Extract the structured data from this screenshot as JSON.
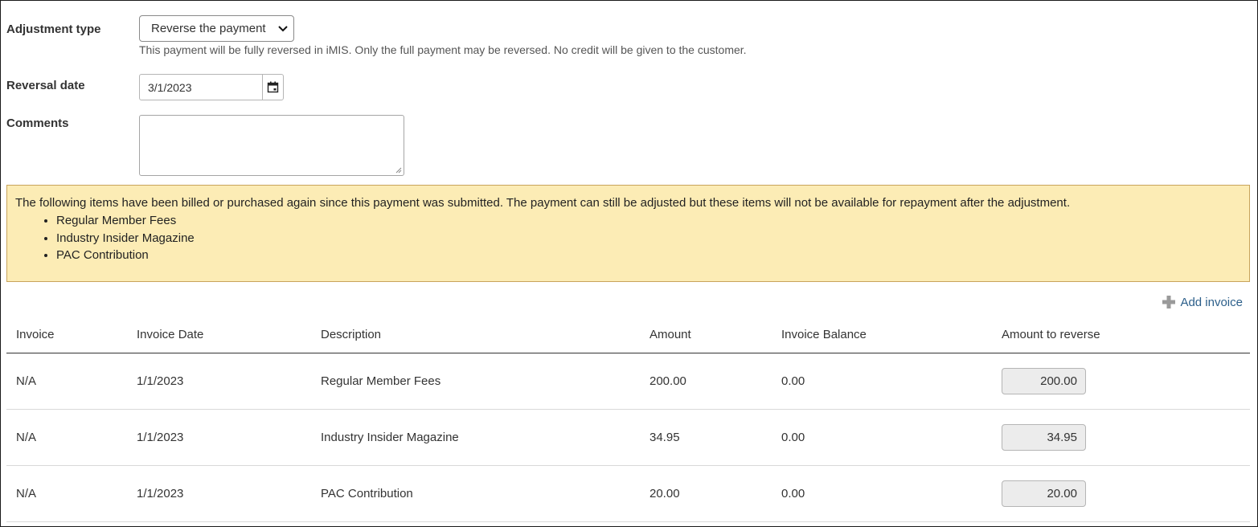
{
  "form": {
    "adjustment_type_label": "Adjustment type",
    "adjustment_type_value": "Reverse the payment",
    "adjustment_hint": "This payment will be fully reversed in iMIS. Only the full payment may be reversed. No credit will be given to the customer.",
    "reversal_date_label": "Reversal date",
    "reversal_date_value": "3/1/2023",
    "comments_label": "Comments",
    "comments_value": ""
  },
  "warning": {
    "message": "The following items have been billed or purchased again since this payment was submitted. The payment can still be adjusted but these items will not be available for repayment after the adjustment.",
    "items": [
      "Regular Member Fees",
      "Industry Insider Magazine",
      "PAC Contribution"
    ]
  },
  "add_invoice_label": "Add invoice",
  "table": {
    "headers": [
      "Invoice",
      "Invoice Date",
      "Description",
      "Amount",
      "Invoice Balance",
      "Amount to reverse"
    ],
    "rows": [
      {
        "invoice": "N/A",
        "date": "1/1/2023",
        "description": "Regular Member Fees",
        "amount": "200.00",
        "balance": "0.00",
        "reverse": "200.00"
      },
      {
        "invoice": "N/A",
        "date": "1/1/2023",
        "description": "Industry Insider Magazine",
        "amount": "34.95",
        "balance": "0.00",
        "reverse": "34.95"
      },
      {
        "invoice": "N/A",
        "date": "1/1/2023",
        "description": "PAC Contribution",
        "amount": "20.00",
        "balance": "0.00",
        "reverse": "20.00"
      }
    ]
  },
  "icons": {
    "select_arrow": "chevron-down-icon",
    "calendar": "calendar-icon",
    "add": "plus-icon"
  },
  "colors": {
    "warning_bg": "#fcecb5",
    "warning_border": "#c8a45c",
    "link": "#2c5f8a"
  }
}
